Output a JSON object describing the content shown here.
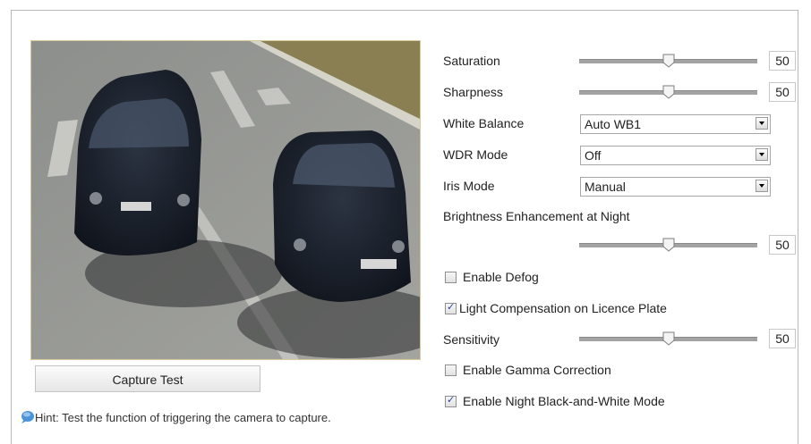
{
  "capture": {
    "button_label": "Capture Test"
  },
  "hint": {
    "text": "Hint: Test the function of triggering the camera to capture.",
    "icon": "info-bubble-icon"
  },
  "settings": {
    "saturation": {
      "label": "Saturation",
      "value": "50",
      "fraction": 0.5
    },
    "sharpness": {
      "label": "Sharpness",
      "value": "50",
      "fraction": 0.5
    },
    "white_balance": {
      "label": "White Balance",
      "selected": "Auto WB1"
    },
    "wdr_mode": {
      "label": "WDR Mode",
      "selected": "Off"
    },
    "iris_mode": {
      "label": "Iris Mode",
      "selected": "Manual"
    },
    "brightness_night": {
      "label": "Brightness Enhancement at Night",
      "value": "50",
      "fraction": 0.5
    },
    "enable_defog": {
      "label": "Enable Defog",
      "checked": false
    },
    "light_compensation": {
      "label": "Light Compensation on Licence Plate",
      "checked": true
    },
    "sensitivity": {
      "label": "Sensitivity",
      "value": "50",
      "fraction": 0.5
    },
    "gamma_correction": {
      "label": "Enable Gamma Correction",
      "checked": false
    },
    "night_bw": {
      "label": "Enable Night Black-and-White Mode",
      "checked": true
    }
  }
}
